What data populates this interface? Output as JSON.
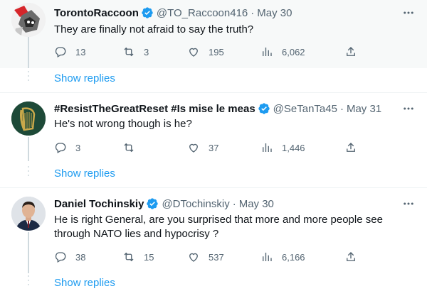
{
  "tweets": [
    {
      "name": "TorontoRaccoon",
      "handle": "@TO_Raccoon416",
      "date": "May 30",
      "text": "They are finally not afraid to say the truth?",
      "replies": "13",
      "retweets": "3",
      "likes": "195",
      "views": "6,062",
      "avatar": "raccoon-avatar"
    },
    {
      "name": "#ResistTheGreatReset #Is mise le meas",
      "handle": "@SeTanTa45",
      "date": "May 31",
      "text": "He's not wrong though is he?",
      "replies": "3",
      "retweets": "",
      "likes": "37",
      "views": "1,446",
      "avatar": "irish-harp-avatar"
    },
    {
      "name": "Daniel Tochinskiy",
      "handle": "@DTochinskiy",
      "date": "May 30",
      "text": "He is right General,  are you surprised that more and more people see through NATO lies and hypocrisy ?",
      "replies": "38",
      "retweets": "15",
      "likes": "537",
      "views": "6,166",
      "avatar": "man-in-suit-avatar"
    }
  ],
  "show_replies_label": "Show replies",
  "dot_separator": "·",
  "colors": {
    "accent": "#1d9bf0",
    "secondary_text": "#536471",
    "harp_green": "#1e4a38",
    "harp_gold": "#c9a84a"
  }
}
